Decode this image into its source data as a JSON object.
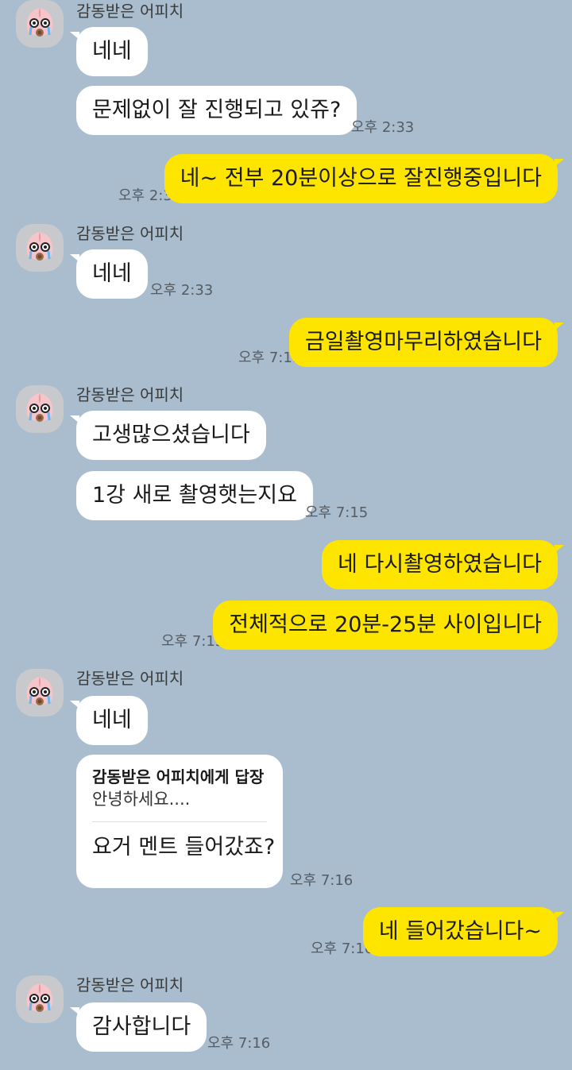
{
  "sender_name": "감동받은 어피치",
  "colors": {
    "background": "#a9bdce",
    "incoming": "#ffffff",
    "outgoing": "#fee500"
  },
  "avatar_icon": "apeach-crying-icon",
  "messages": {
    "m1": "네네",
    "m2": "문제없이 잘 진행되고 있쥬?",
    "t2": "오후 2:33",
    "m3": "네~ 전부 20분이상으로 잘진행중입니다",
    "t3": "오후 2:33",
    "m4": "네네",
    "t4": "오후 2:33",
    "m5": "금일촬영마무리하였습니다",
    "t5": "오후 7:11",
    "m6": "고생많으셨습니다",
    "m7": "1강 새로 촬영햇는지요",
    "t7": "오후 7:15",
    "m8": "네 다시촬영하였습니다",
    "m9": "전체적으로 20분-25분 사이입니다",
    "t9": "오후 7:15",
    "m10": "네네",
    "reply_head": "감동받은 어피치에게 답장",
    "reply_quote": "안녕하세요....",
    "reply_body": "요거 멘트 들어갔죠?",
    "t11": "오후 7:16",
    "m12": "네 들어갔습니다~",
    "t12": "오후 7:16",
    "m13": "감사합니다",
    "t13": "오후 7:16"
  }
}
